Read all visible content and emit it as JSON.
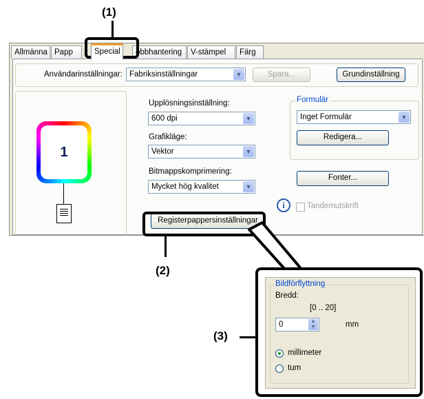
{
  "callouts": {
    "one": "(1)",
    "two": "(2)",
    "three": "(3)"
  },
  "tabs": [
    {
      "label": "Allmänna"
    },
    {
      "label": "Papp"
    },
    {
      "label": "Special",
      "active": true
    },
    {
      "label": "obbhantering"
    },
    {
      "label": "V-stämpel"
    },
    {
      "label": "Färg"
    }
  ],
  "user_settings": {
    "label": "Användarinställningar:",
    "value": "Fabriksinställningar",
    "save_label": "Spara...",
    "default_label": "Grundinställning"
  },
  "preview": {
    "page_number": "1"
  },
  "resolution": {
    "label": "Upplösningsinställning:",
    "value": "600 dpi"
  },
  "graphics": {
    "label": "Grafikläge:",
    "value": "Vektor"
  },
  "bitmap": {
    "label": "Bitmappskomprimering:",
    "value": "Mycket hög kvalitet"
  },
  "form": {
    "group_title": "Formulär",
    "value": "Inget Formulär",
    "edit_label": "Redigera..."
  },
  "fonts_label": "Fonter...",
  "tandem": {
    "label": "Tandemutskrift",
    "checked": false
  },
  "tab_paper_button": "Registerpappersinställningar",
  "image_shift": {
    "group_title": "Bildförflyttning",
    "width_label": "Bredd:",
    "range": "[0 .. 20]",
    "value": "0",
    "unit": "mm",
    "options": [
      {
        "label": "millimeter",
        "selected": true
      },
      {
        "label": "tum",
        "selected": false
      }
    ]
  }
}
